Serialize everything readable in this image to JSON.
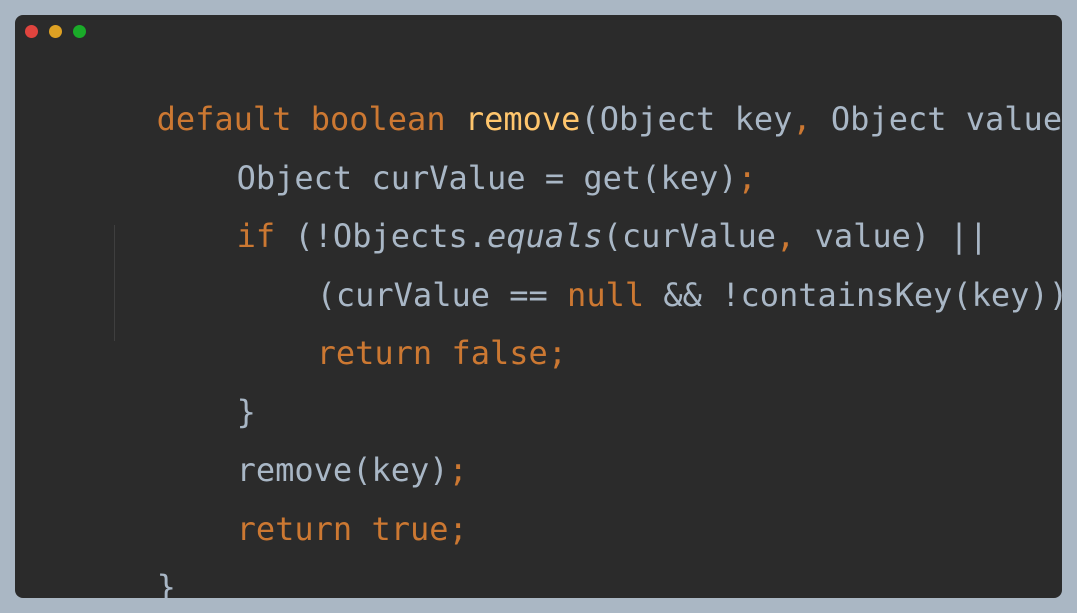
{
  "window": {
    "controls": {
      "close_color": "#e0443e",
      "minimize_color": "#dea123",
      "maximize_color": "#1aab29"
    }
  },
  "theme": {
    "background": "#2b2b2b",
    "plain_text": "#a9b7c6",
    "keyword": "#cc7832",
    "function_name": "#ffc66d"
  },
  "code": {
    "lines": [
      [
        {
          "text": "default boolean ",
          "style": "kw"
        },
        {
          "text": "remove",
          "style": "fn"
        },
        {
          "text": "(Object key",
          "style": "pl"
        },
        {
          "text": ", ",
          "style": "kw"
        },
        {
          "text": "Object value) {",
          "style": "pl"
        }
      ],
      [
        {
          "text": "Object curValue = get(key)",
          "style": "pl"
        },
        {
          "text": ";",
          "style": "kw"
        }
      ],
      [
        {
          "text": "if ",
          "style": "kw"
        },
        {
          "text": "(!Objects.",
          "style": "pl"
        },
        {
          "text": "equals",
          "style": "it"
        },
        {
          "text": "(curValue",
          "style": "pl"
        },
        {
          "text": ", ",
          "style": "kw"
        },
        {
          "text": "value) ||",
          "style": "pl"
        }
      ],
      [
        {
          "text": "(curValue == ",
          "style": "pl"
        },
        {
          "text": "null ",
          "style": "kw"
        },
        {
          "text": "&& !containsKey(key))) {",
          "style": "pl"
        }
      ],
      [
        {
          "text": "return false;",
          "style": "kw"
        }
      ],
      [
        {
          "text": "}",
          "style": "pl"
        }
      ],
      [
        {
          "text": "remove(key)",
          "style": "pl"
        },
        {
          "text": ";",
          "style": "kw"
        }
      ],
      [
        {
          "text": "return true;",
          "style": "kw"
        }
      ],
      [
        {
          "text": "}",
          "style": "pl"
        }
      ]
    ]
  }
}
